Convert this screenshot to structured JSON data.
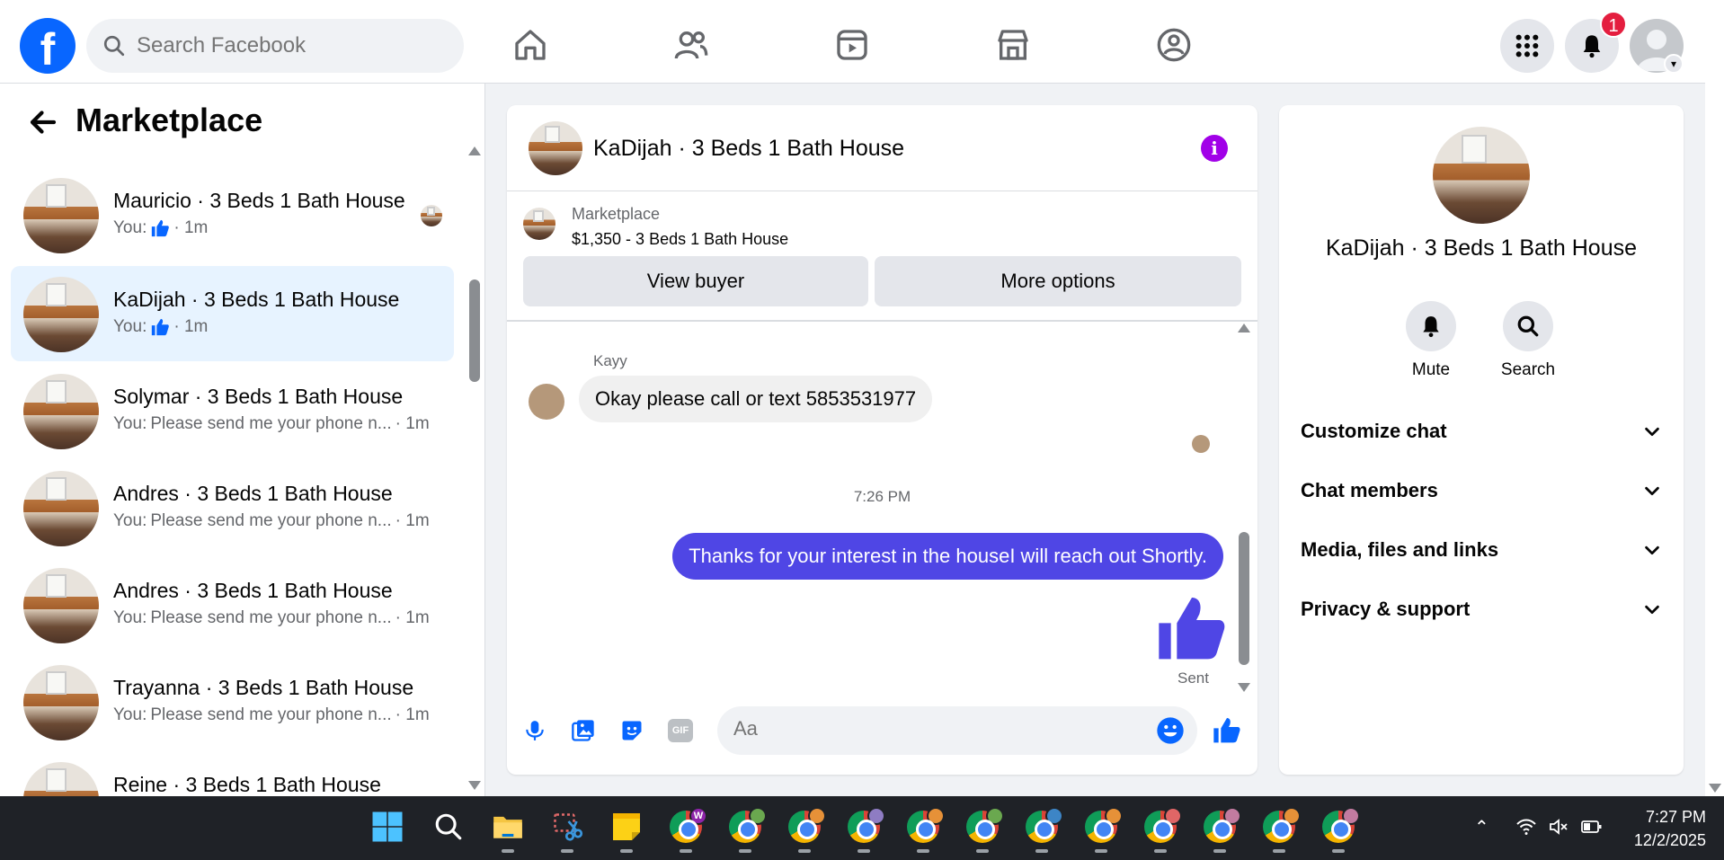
{
  "search": {
    "placeholder": "Search Facebook"
  },
  "header": {
    "notification_count": "1",
    "logo": "f"
  },
  "sidebar": {
    "title": "Marketplace",
    "conversations": [
      {
        "name": "Mauricio · 3 Beds 1 Bath House",
        "preview_prefix": "You:",
        "preview": "",
        "time": "· 1m",
        "like": true
      },
      {
        "name": "KaDijah · 3 Beds 1 Bath House",
        "preview_prefix": "You:",
        "preview": "",
        "time": "· 1m",
        "like": true
      },
      {
        "name": "Solymar · 3 Beds 1 Bath House",
        "preview_prefix": "You:",
        "preview": "Please send me your phone n...",
        "time": "· 1m",
        "like": false
      },
      {
        "name": "Andres · 3 Beds 1 Bath House",
        "preview_prefix": "You:",
        "preview": "Please send me your phone n...",
        "time": "· 1m",
        "like": false
      },
      {
        "name": "Andres · 3 Beds 1 Bath House",
        "preview_prefix": "You:",
        "preview": "Please send me your phone n...",
        "time": "· 1m",
        "like": false
      },
      {
        "name": "Trayanna · 3 Beds 1 Bath House",
        "preview_prefix": "You:",
        "preview": "Please send me your phone n...",
        "time": "· 1m",
        "like": false
      },
      {
        "name": "Reine · 3 Beds 1 Bath House",
        "preview_prefix": "",
        "preview": "",
        "time": "",
        "like": false
      }
    ]
  },
  "chat": {
    "title": "KaDijah · 3 Beds 1 Bath House",
    "listing_source": "Marketplace",
    "listing_price": "$1,350 - 3 Beds 1 Bath House",
    "view_buyer": "View buyer",
    "more_options": "More options",
    "sender": "Kayy",
    "incoming": "Okay please call or text 5853531977",
    "timestamp": "7:26 PM",
    "outgoing": "Thanks for your interest in the houseI will reach out Shortly.",
    "sent_label": "Sent",
    "composer_placeholder": "Aa",
    "gif_label": "GIF"
  },
  "right_panel": {
    "title": "KaDijah · 3 Beds 1 Bath House",
    "mute": "Mute",
    "search": "Search",
    "sections": [
      "Customize chat",
      "Chat members",
      "Media, files and links",
      "Privacy & support"
    ]
  },
  "taskbar": {
    "time": "7:27 PM",
    "date": "12/2/2025",
    "chrome_badges": [
      "W",
      "",
      "",
      "",
      "",
      "",
      "",
      "",
      "",
      "",
      "",
      ""
    ],
    "chrome_badge_colors": [
      "#8e24aa",
      "#6aa84f",
      "#e69138",
      "#8e7cc3",
      "#e69138",
      "#6aa84f",
      "#3d85c6",
      "#e69138",
      "#e06666",
      "#c27ba0",
      "#e69138",
      "#c27ba0"
    ]
  },
  "colors": {
    "brand": "#0866ff",
    "outgoing_bubble": "#4f46e5",
    "info_button": "#a100e8",
    "active_conversation": "#e7f3ff",
    "badge": "#e41e3f"
  }
}
